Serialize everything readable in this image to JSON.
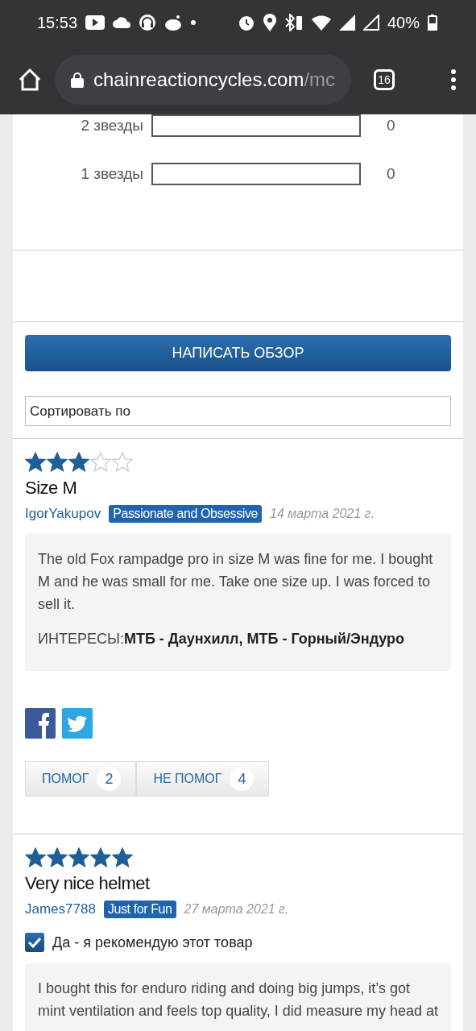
{
  "status_bar": {
    "time": "15:53",
    "battery": "40%"
  },
  "browser": {
    "domain": "chainreactioncycles.com",
    "path": "/mc",
    "tab_count": "16"
  },
  "rating_rows": [
    {
      "label": "2 звезды",
      "level": 0,
      "count": "0"
    },
    {
      "label": "1 звезды",
      "level": 0,
      "count": "0"
    }
  ],
  "write_review_button": "НАПИСАТЬ ОБЗОР",
  "sort": {
    "placeholder": "Сортировать по"
  },
  "reviews": [
    {
      "stars": 3,
      "title": "Size M",
      "author": "IgorYakupov",
      "badge": "Passionate and Obsessive",
      "date": "14 марта 2021 г.",
      "body": "The old Fox rampadge pro in size M was fine for me. I bought M and he was small for me. Take one size up. I was forced to sell it.",
      "interests": "ИНТЕРЕСЫ:**МТБ - Даунхилл, МТБ - Горный/Эндуро**",
      "helpful": {
        "label": "ПОМОГ",
        "count": "2"
      },
      "unhelpful": {
        "label": "НЕ ПОМОГ",
        "count": "4"
      }
    },
    {
      "stars": 5,
      "title": "Very nice helmet",
      "author": "James7788",
      "badge": "Just for Fun",
      "date": "27 марта 2021 г.",
      "recommend": {
        "checked": true,
        "label": "Да - я рекомендую этот товар"
      },
      "body": "I bought this for enduro riding and doing big jumps, it’s got mint ventilation and feels top quality, I did measure my head at"
    }
  ]
}
